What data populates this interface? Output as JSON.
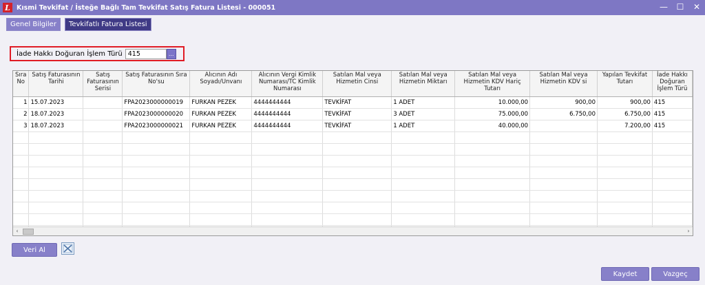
{
  "window": {
    "title": "Kısmi Tevkifat / İsteğe Bağlı Tam Tevkifat Satış Fatura Listesi - 000051",
    "controls": {
      "minimize": "—",
      "maximize": "☐",
      "close": "✕"
    }
  },
  "tabs": [
    {
      "label": "Genel Bilgiler",
      "active": false
    },
    {
      "label": "Tevkifatlı Fatura Listesi",
      "active": true
    }
  ],
  "filter": {
    "label": "İade Hakkı Doğuran İşlem Türü",
    "value": "415",
    "lookup_label": "..."
  },
  "table": {
    "columns": [
      "Sıra No",
      "Satış Faturasının Tarihi",
      "Satış Faturasının Serisi",
      "Satış Faturasının Sıra No'su",
      "Alıcının Adı Soyadı/Unvanı",
      "Alıcının Vergi Kimlik Numarası/TC Kimlik Numarası",
      "Satılan Mal veya Hizmetin Cinsi",
      "Satılan Mal veya Hizmetin Miktarı",
      "Satılan Mal veya Hizmetin KDV Hariç Tutarı",
      "Satılan Mal veya Hizmetin KDV si",
      "Yapılan Tevkifat Tutarı",
      "İade Hakkı Doğuran İşlem Türü"
    ],
    "rows": [
      [
        "1",
        "15.07.2023",
        "",
        "FPA2023000000019",
        "FURKAN PEZEK",
        "4444444444",
        "TEVKİFAT",
        "1 ADET",
        "10.000,00",
        "900,00",
        "900,00",
        "415"
      ],
      [
        "2",
        "18.07.2023",
        "",
        "FPA2023000000020",
        "FURKAN PEZEK",
        "4444444444",
        "TEVKİFAT",
        "3 ADET",
        "75.000,00",
        "6.750,00",
        "6.750,00",
        "415"
      ],
      [
        "3",
        "18.07.2023",
        "",
        "FPA2023000000021",
        "FURKAN PEZEK",
        "4444444444",
        "TEVKİFAT",
        "1 ADET",
        "40.000,00",
        "",
        "7.200,00",
        "415"
      ]
    ]
  },
  "scroll": {
    "left_arrow": "‹",
    "right_arrow": "›"
  },
  "buttons": {
    "veri_al": "Veri Al",
    "kaydet": "Kaydet",
    "vazgec": "Vazgeç"
  }
}
